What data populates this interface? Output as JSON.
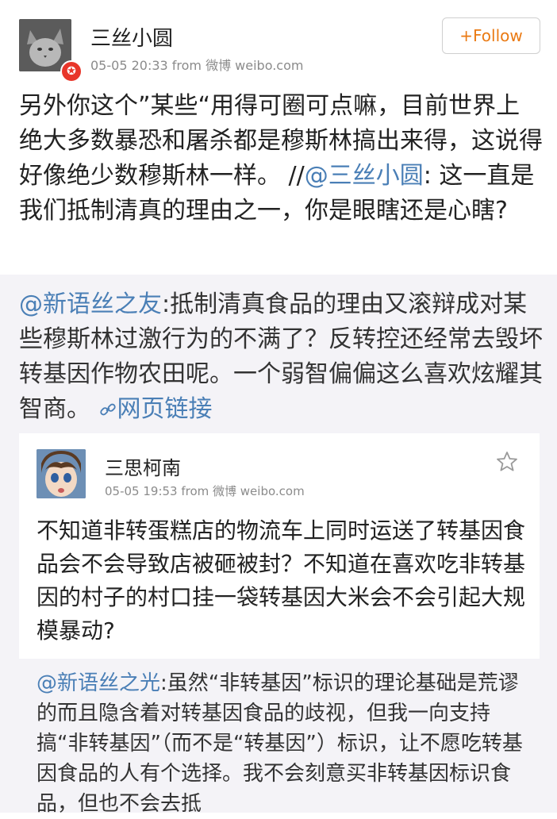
{
  "post": {
    "author": "三丝小圆",
    "meta": "05-05 20:33  from  微博 weibo.com",
    "follow_label": "Follow",
    "text_part1": "另外你这个”某些“用得可圈可点嘛，目前世界上绝大多数暴恐和屠杀都是穆斯林搞出来得，这说得好像绝少数穆斯林一样。 //",
    "mention": "@三丝小圆",
    "text_part2": ": 这一直是我们抵制清真的理由之一，你是眼瞎还是心瞎?"
  },
  "repost": {
    "mention": "@新语丝之友",
    "text": ":抵制清真食品的理由又滚辩成对某些穆斯林过激行为的不满了？反转控还经常去毁坏转基因作物农田呢。一个弱智偏偏这么喜欢炫耀其智商。",
    "link_label": "网页链接"
  },
  "inner_post": {
    "author": "三思柯南",
    "meta": "05-05 19:53  from  微博 weibo.com",
    "text": "不知道非转蛋糕店的物流车上同时运送了转基因食品会不会导致店被砸被封？不知道在喜欢吃非转基因的村子的村口挂一袋转基因大米会不会引起大规模暴动?",
    "quoted_mention": "@新语丝之光",
    "quoted_text": ":虽然“非转基因”标识的理论基础是荒谬的而且隐含着对转基因食品的歧视，但我一向支持搞“非转基因”（而不是“转基因”）标识，让不愿吃转基因食品的人有个选择。我不会刻意买非转基因标识食品，但也不会去抵"
  },
  "icons": {
    "avatar1": "cat-avatar",
    "badge": "verified-badge-icon",
    "follow": "plus-icon",
    "link": "link-icon",
    "avatar2": "anime-avatar",
    "star": "star-icon"
  },
  "colors": {
    "accent_link": "#4a7fb6",
    "follow": "#ea7a13",
    "badge": "#e8362a",
    "repost_bg": "#f4f3f7"
  }
}
